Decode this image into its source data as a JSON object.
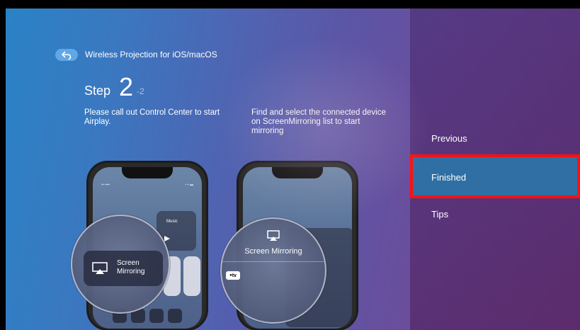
{
  "header": {
    "title": "Wireless Projection for iOS/macOS"
  },
  "step": {
    "label": "Step",
    "number": "2",
    "total": "-2"
  },
  "instructions": {
    "left": "Please call out Control Center to start Airplay.",
    "right": "Find and select the connected device on ScreenMirroring list to start mirroring"
  },
  "phone1": {
    "music_label": "Music",
    "screen_mirroring_label": "Screen\nMirroring"
  },
  "phone2": {
    "screen_mirroring_label": "Screen Mirroring",
    "apple_tv_badge": "tv"
  },
  "menu": {
    "items": [
      {
        "label": "Previous",
        "selected": false
      },
      {
        "label": "Finished",
        "selected": true
      },
      {
        "label": "Tips",
        "selected": false
      }
    ]
  },
  "colors": {
    "selected_bg": "#2f6fa3",
    "highlight_border": "#ff1010",
    "back_button": "#5fa7e6"
  },
  "icons": {
    "back": "back-arrow-icon",
    "airplay": "airplay-icon"
  }
}
